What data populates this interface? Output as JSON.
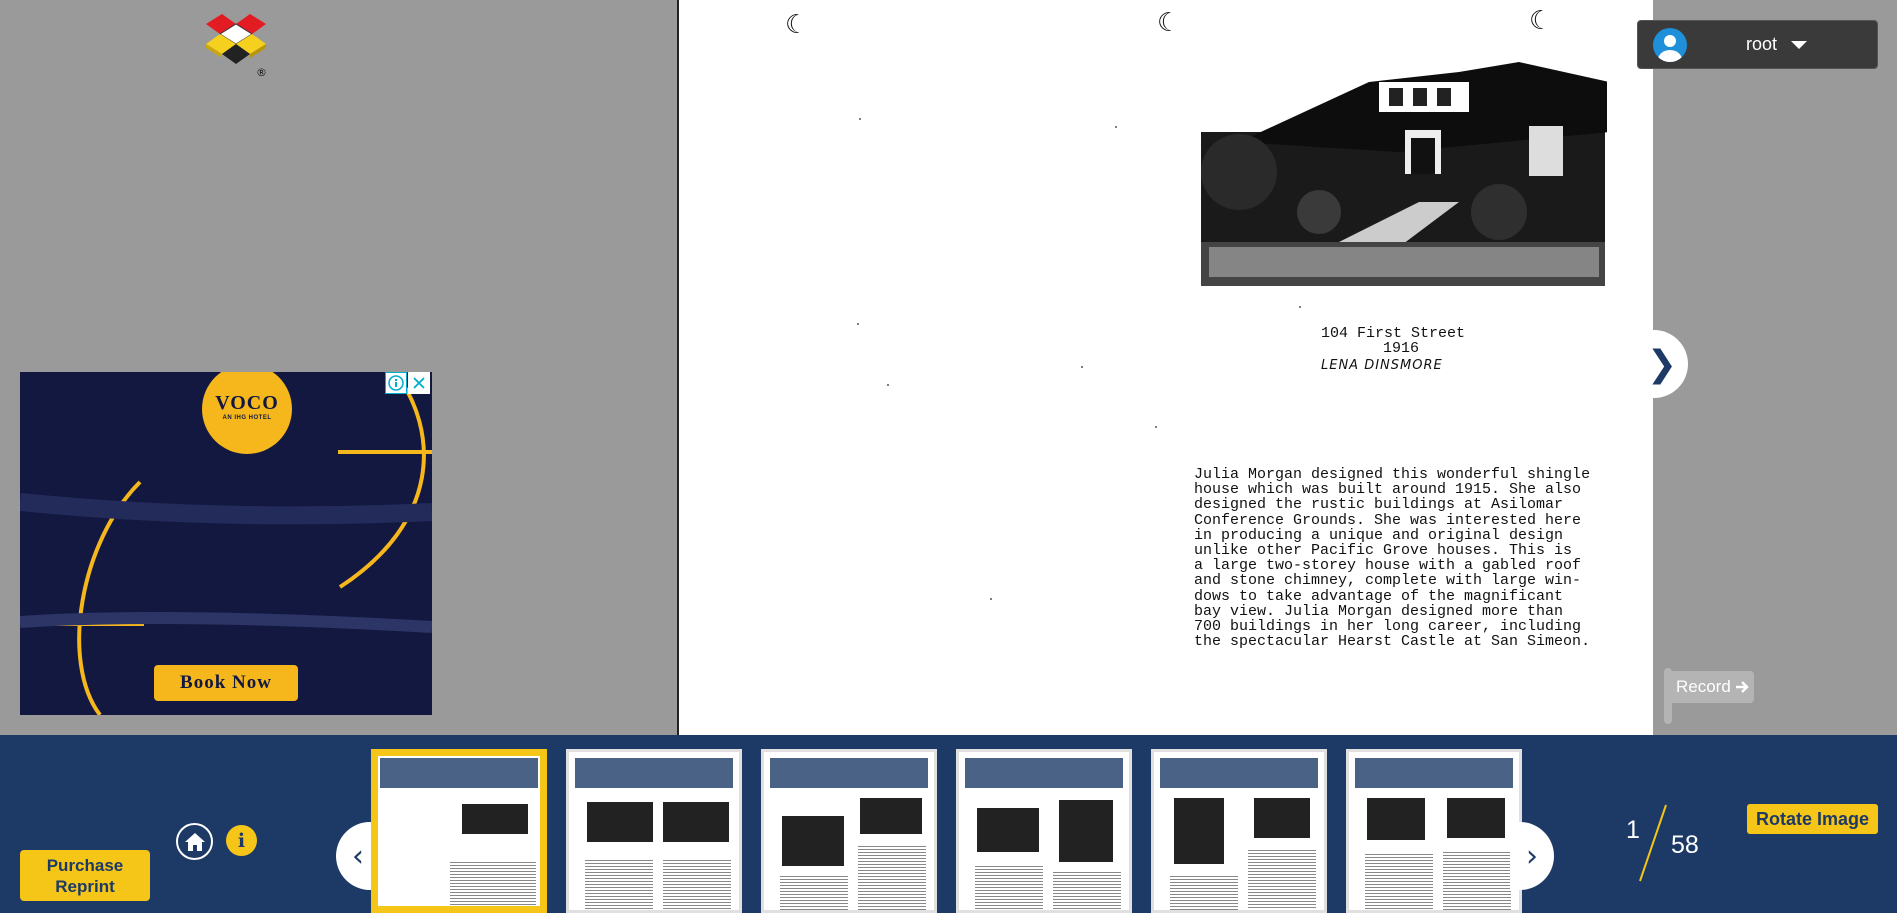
{
  "logo": {
    "icon": "cubes-logo-icon",
    "mark": "®"
  },
  "ad": {
    "brand": "VOCO",
    "sub": "AN IHG HOTEL",
    "cta": "Book Now",
    "info_icon": "info-icon",
    "close_icon": "close-icon",
    "colors": {
      "bg": "#121840",
      "accent": "#f5b71c"
    }
  },
  "document": {
    "address_line": "104 First Street",
    "year": "1916",
    "owner": "LENA DINSMORE",
    "body": "Julia Morgan designed this wonderful shingle\nhouse which was built around 1915.  She also\ndesigned the rustic buildings at Asilomar\nConference Grounds.  She was interested here\nin producing a unique and original design\nunlike other Pacific Grove houses.  This is\na large two-storey house with a gabled roof\nand stone chimney, complete with large win-\ndows to take advantage of the magnificant\nbay view.  Julia Morgan designed more than\n700 buildings in her long career, including\nthe spectacular Hearst Castle at San Simeon."
  },
  "user": {
    "name": "root",
    "avatar_icon": "user-avatar-icon"
  },
  "record": {
    "label": "Record",
    "icon": "arrow-right-icon"
  },
  "bottombar": {
    "purchase_label": "Purchase Reprint",
    "home_icon": "home-icon",
    "info_icon": "info-icon",
    "rotate_label": "Rotate Image",
    "current_page": "1",
    "total_pages": "58",
    "thumbnail_count": 6,
    "active_thumbnail": 1,
    "colors": {
      "bar": "#1d3a66",
      "accent": "#f5c518"
    }
  }
}
